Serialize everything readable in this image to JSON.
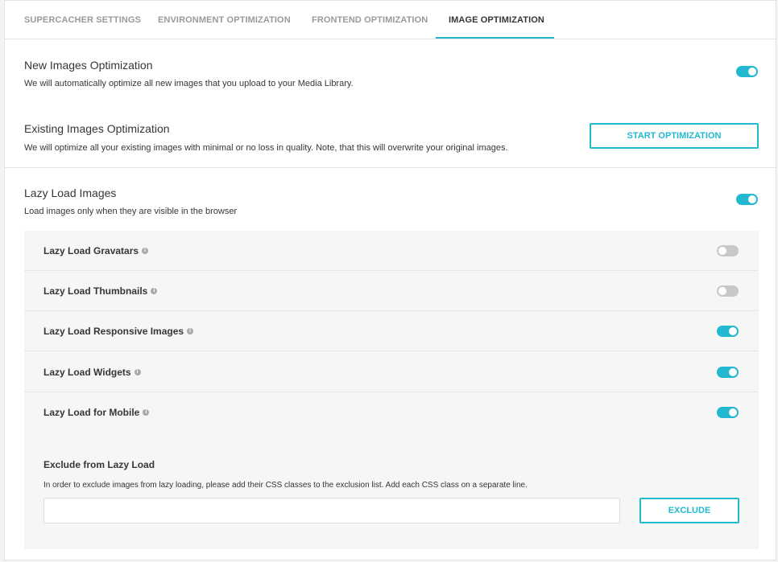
{
  "tabs": [
    {
      "label": "SUPERCACHER SETTINGS",
      "active": false
    },
    {
      "label": "ENVIRONMENT OPTIMIZATION",
      "active": false
    },
    {
      "label": "FRONTEND OPTIMIZATION",
      "active": false
    },
    {
      "label": "IMAGE OPTIMIZATION",
      "active": true
    }
  ],
  "new_images": {
    "title": "New Images Optimization",
    "description": "We will automatically optimize all new images that you upload to your Media Library.",
    "enabled": true
  },
  "existing_images": {
    "title": "Existing Images Optimization",
    "description": "We will optimize all your existing images with minimal or no loss in quality. Note, that this will overwrite your original images.",
    "button_label": "START OPTIMIZATION"
  },
  "lazy_load": {
    "title": "Lazy Load Images",
    "description": "Load images only when they are visible in the browser",
    "enabled": true,
    "options": [
      {
        "label": "Lazy Load Gravatars",
        "enabled": false
      },
      {
        "label": "Lazy Load Thumbnails",
        "enabled": false
      },
      {
        "label": "Lazy Load Responsive Images",
        "enabled": true
      },
      {
        "label": "Lazy Load Widgets",
        "enabled": true
      },
      {
        "label": "Lazy Load for Mobile",
        "enabled": true
      }
    ],
    "exclude": {
      "title": "Exclude from Lazy Load",
      "description": "In order to exclude images from lazy loading, please add their CSS classes to the exclusion list. Add each CSS class on a separate line.",
      "input_value": "",
      "input_placeholder": "",
      "button_label": "EXCLUDE"
    }
  },
  "icons": {
    "info": "info-icon",
    "info_glyph": "i"
  },
  "colors": {
    "accent": "#22b8cf",
    "toggle_off": "#c8c8c8"
  }
}
